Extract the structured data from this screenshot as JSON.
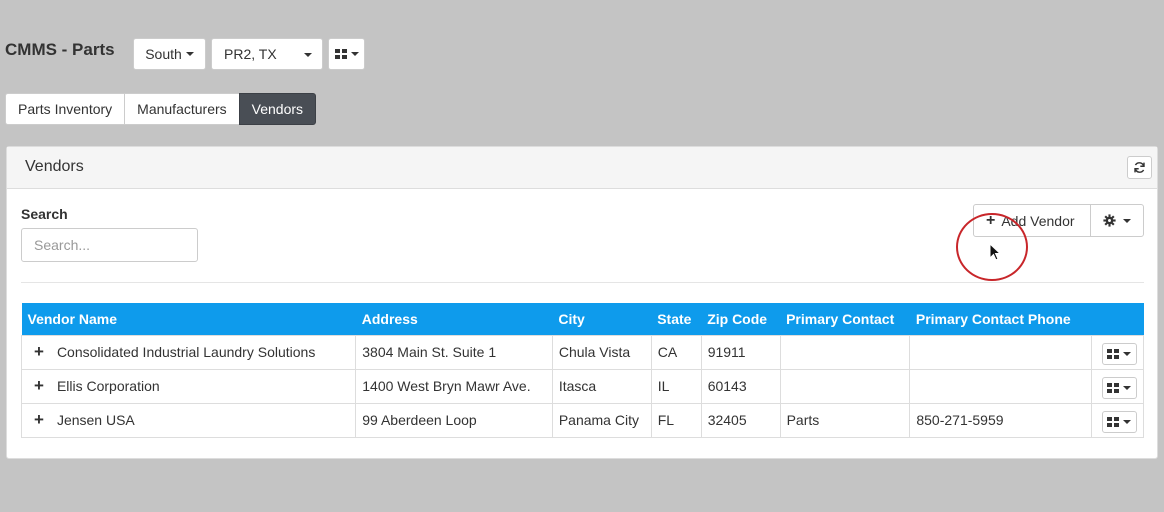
{
  "header": {
    "title": "CMMS - Parts",
    "region": "South",
    "site": "PR2, TX"
  },
  "tabs": [
    {
      "label": "Parts Inventory",
      "active": false
    },
    {
      "label": "Manufacturers",
      "active": false
    },
    {
      "label": "Vendors",
      "active": true
    }
  ],
  "panel": {
    "title": "Vendors",
    "search_label": "Search",
    "search_placeholder": "Search...",
    "search_value": "",
    "add_label": "Add Vendor"
  },
  "table": {
    "columns": [
      "Vendor Name",
      "Address",
      "City",
      "State",
      "Zip Code",
      "Primary Contact",
      "Primary Contact Phone"
    ],
    "rows": [
      {
        "name": "Consolidated Industrial Laundry Solutions",
        "address": "3804 Main St. Suite 1",
        "city": "Chula Vista",
        "state": "CA",
        "zip": "91911",
        "contact": "",
        "phone": ""
      },
      {
        "name": "Ellis Corporation",
        "address": "1400 West Bryn Mawr Ave.",
        "city": "Itasca",
        "state": "IL",
        "zip": "60143",
        "contact": "",
        "phone": ""
      },
      {
        "name": "Jensen USA",
        "address": "99 Aberdeen Loop",
        "city": "Panama City",
        "state": "FL",
        "zip": "32405",
        "contact": "Parts",
        "phone": "850-271-5959"
      }
    ]
  },
  "colors": {
    "table_header": "#0e9bec",
    "active_tab": "#494e55",
    "click_indicator": "#c8262a",
    "background": "#c4c4c4"
  }
}
